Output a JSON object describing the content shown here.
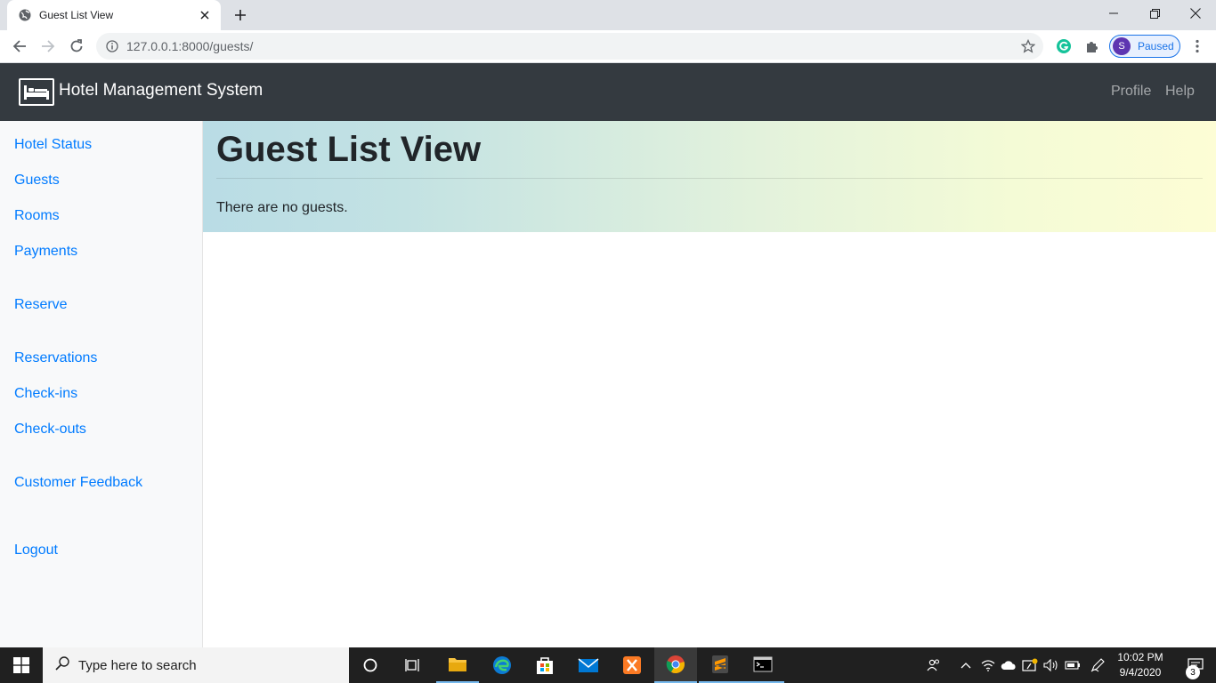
{
  "browser": {
    "tab_title": "Guest List View",
    "url": "127.0.0.1:8000/guests/",
    "profile_initial": "S",
    "profile_status": "Paused"
  },
  "navbar": {
    "brand": "Hotel Management System",
    "links": {
      "profile": "Profile",
      "help": "Help"
    }
  },
  "sidebar": {
    "items": [
      {
        "label": "Hotel Status"
      },
      {
        "label": "Guests"
      },
      {
        "label": "Rooms"
      },
      {
        "label": "Payments"
      },
      {
        "label": "Reserve"
      },
      {
        "label": "Reservations"
      },
      {
        "label": "Check-ins"
      },
      {
        "label": "Check-outs"
      },
      {
        "label": "Customer Feedback"
      },
      {
        "label": "Logout"
      }
    ]
  },
  "main": {
    "title": "Guest List View",
    "message": "There are no guests."
  },
  "taskbar": {
    "search_placeholder": "Type here to search",
    "time": "10:02 PM",
    "date": "9/4/2020",
    "notification_count": "3"
  },
  "colors": {
    "navbar_bg": "#343a40",
    "link": "#007bff",
    "sidebar_bg": "#f8f9fa"
  }
}
